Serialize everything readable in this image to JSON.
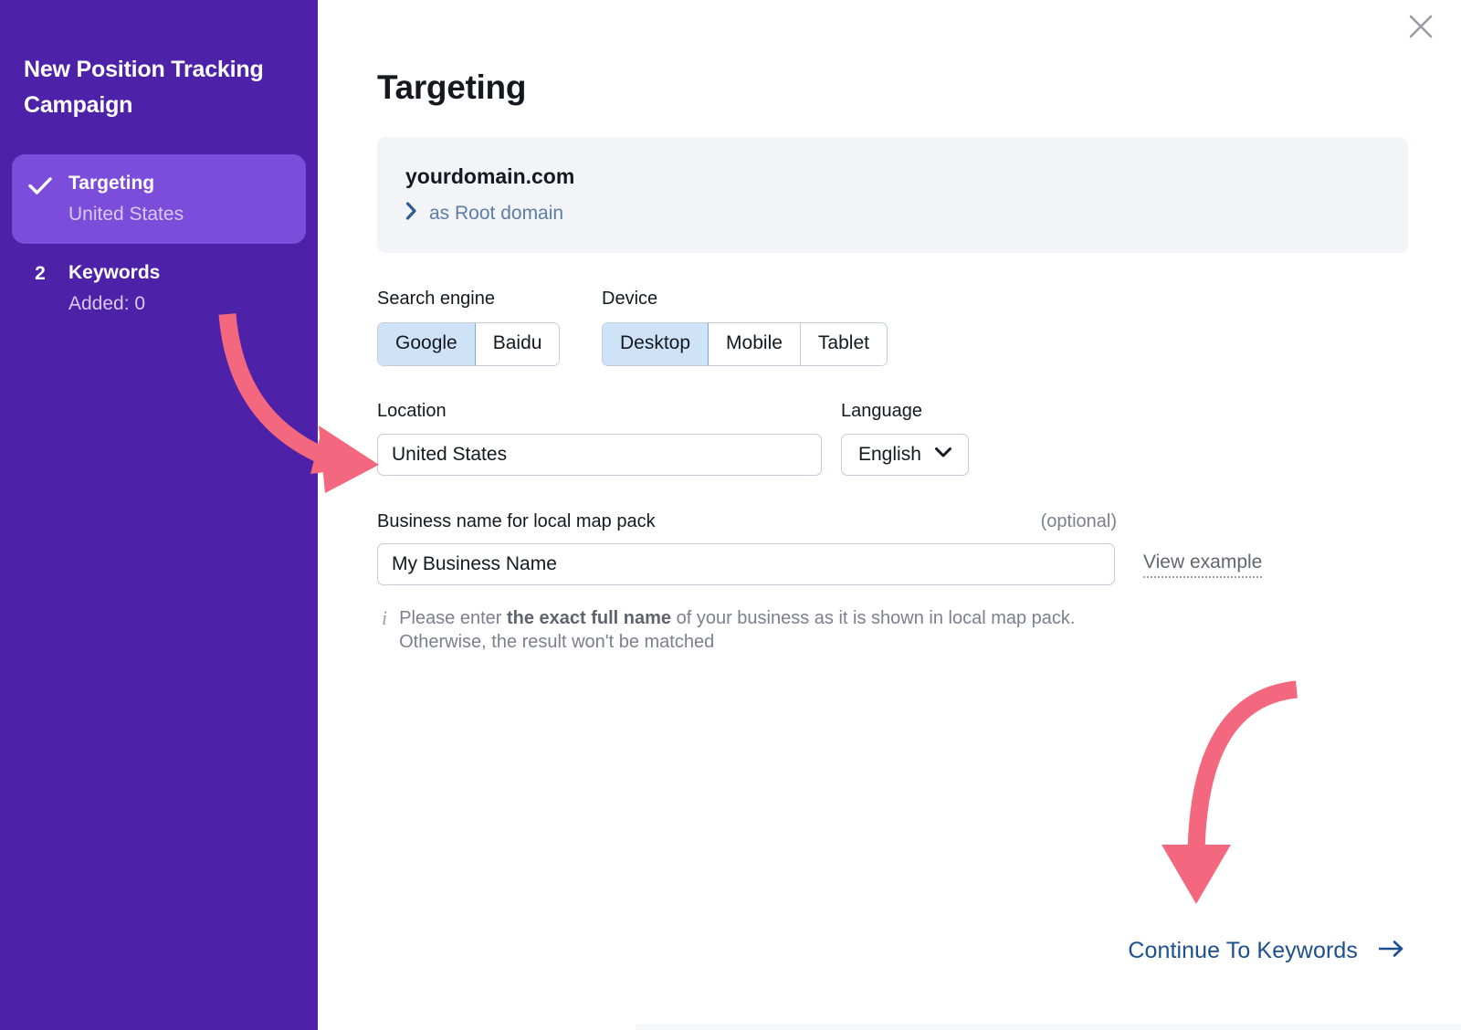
{
  "sidebar": {
    "campaign_title": "New Position Tracking Campaign",
    "steps": [
      {
        "marker": "check",
        "name": "Targeting",
        "sub": "United States",
        "active": true
      },
      {
        "marker": "2",
        "name": "Keywords",
        "sub": "Added: 0",
        "active": false
      }
    ]
  },
  "main": {
    "page_title": "Targeting",
    "close_label": "close-icon",
    "domain_card": {
      "domain": "yourdomain.com",
      "scope_label": "as Root domain"
    },
    "search_engine": {
      "label": "Search engine",
      "options": [
        "Google",
        "Baidu"
      ],
      "selected": "Google"
    },
    "device": {
      "label": "Device",
      "options": [
        "Desktop",
        "Mobile",
        "Tablet"
      ],
      "selected": "Desktop"
    },
    "location": {
      "label": "Location",
      "value": "United States",
      "placeholder": "Enter location"
    },
    "language": {
      "label": "Language",
      "value": "English"
    },
    "business": {
      "label": "Business name for local map pack",
      "optional": "(optional)",
      "value": "My Business Name",
      "placeholder": "My Business Name",
      "view_example": "View example",
      "hint_prefix": "Please enter ",
      "hint_bold": "the exact full name",
      "hint_suffix": " of your business as it is shown in local map pack. Otherwise, the result won't be matched"
    },
    "continue": {
      "label": "Continue To Keywords"
    }
  },
  "colors": {
    "sidebar_bg": "#4e22a8",
    "sidebar_active": "#7c4ddb",
    "card_bg": "#f2f4f8",
    "segment_selected": "#cfe3f8",
    "link_blue": "#1c4f8f",
    "annotation_pink": "#f4687f"
  }
}
